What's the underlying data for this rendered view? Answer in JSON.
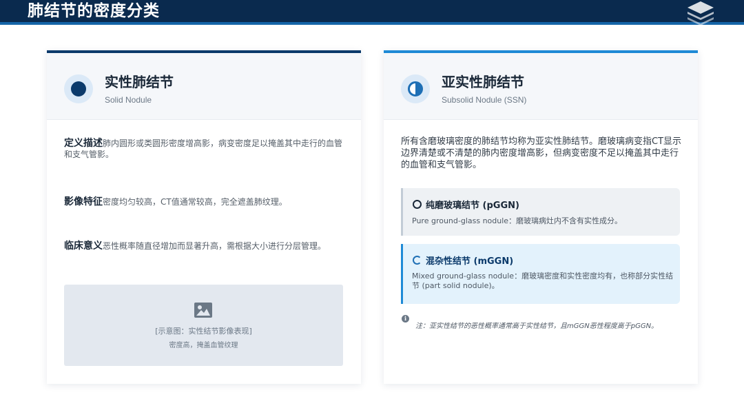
{
  "page": {
    "title": "肺结节的密度分类"
  },
  "solid": {
    "title": "实性肺结节",
    "subtitle": "Solid Nodule",
    "items": [
      {
        "label": "定义描述",
        "text": "肺内圆形或类圆形密度增高影，病变密度足以掩盖其中走行的血管和支气管影。"
      },
      {
        "label": "影像特征",
        "text": "密度均匀较高，CT值通常较高，完全遮盖肺纹理。"
      },
      {
        "label": "临床意义",
        "text": "恶性概率随直径增加而显著升高，需根据大小进行分层管理。"
      }
    ],
    "placeholder": {
      "line1": "[示意图：实性结节影像表现]",
      "line2": "密度高，掩盖血管纹理"
    }
  },
  "subsolid": {
    "title": "亚实性肺结节",
    "subtitle": "Subsolid Nodule (SSN)",
    "intro": "所有含磨玻璃密度的肺结节均称为亚实性肺结节。磨玻璃病变指CT显示边界清楚或不清楚的肺内密度增高影，但病变密度不足以掩盖其中走行的血管和支气管影。",
    "pggn": {
      "title": "纯磨玻璃结节 (pGGN)",
      "desc": "Pure ground-glass nodule：磨玻璃病灶内不含有实性成分。"
    },
    "mggn": {
      "title": "混杂性结节 (mGGN)",
      "desc": "Mixed ground-glass nodule：磨玻璃密度和实性密度均有，也称部分实性结节 (part solid nodule)。"
    },
    "note": "注：亚实性结节的恶性概率通常高于实性结节，且mGGN恶性程度高于pGGN。"
  },
  "colors": {
    "header_bg": "#0a2a4e",
    "accent_dark": "#0b3a6b",
    "accent_light": "#1e8ad6"
  },
  "icons": {
    "header": "layers-icon",
    "solid": "filled-circle-icon",
    "subsolid": "half-circle-icon",
    "placeholder": "image-icon",
    "note": "info-icon"
  }
}
